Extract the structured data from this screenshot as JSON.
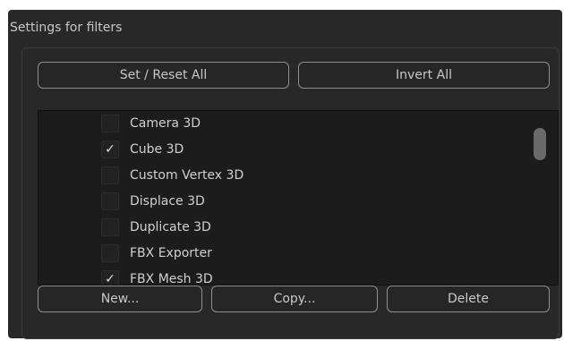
{
  "panel": {
    "title": "Settings for filters"
  },
  "buttons": {
    "set_reset_all": "Set / Reset All",
    "invert_all": "Invert All",
    "new": "New...",
    "copy": "Copy...",
    "delete": "Delete"
  },
  "filters": [
    {
      "label": "Camera 3D",
      "checked": false
    },
    {
      "label": "Cube 3D",
      "checked": true
    },
    {
      "label": "Custom Vertex 3D",
      "checked": false
    },
    {
      "label": "Displace 3D",
      "checked": false
    },
    {
      "label": "Duplicate 3D",
      "checked": false
    },
    {
      "label": "FBX Exporter",
      "checked": false
    },
    {
      "label": "FBX Mesh 3D",
      "checked": true
    }
  ],
  "check_glyph": "✓",
  "colors": {
    "panel_bg": "#282828",
    "list_bg": "#1c1c1c",
    "button_border": "#8f8f8f",
    "scroll_thumb": "#6a6a6a"
  }
}
